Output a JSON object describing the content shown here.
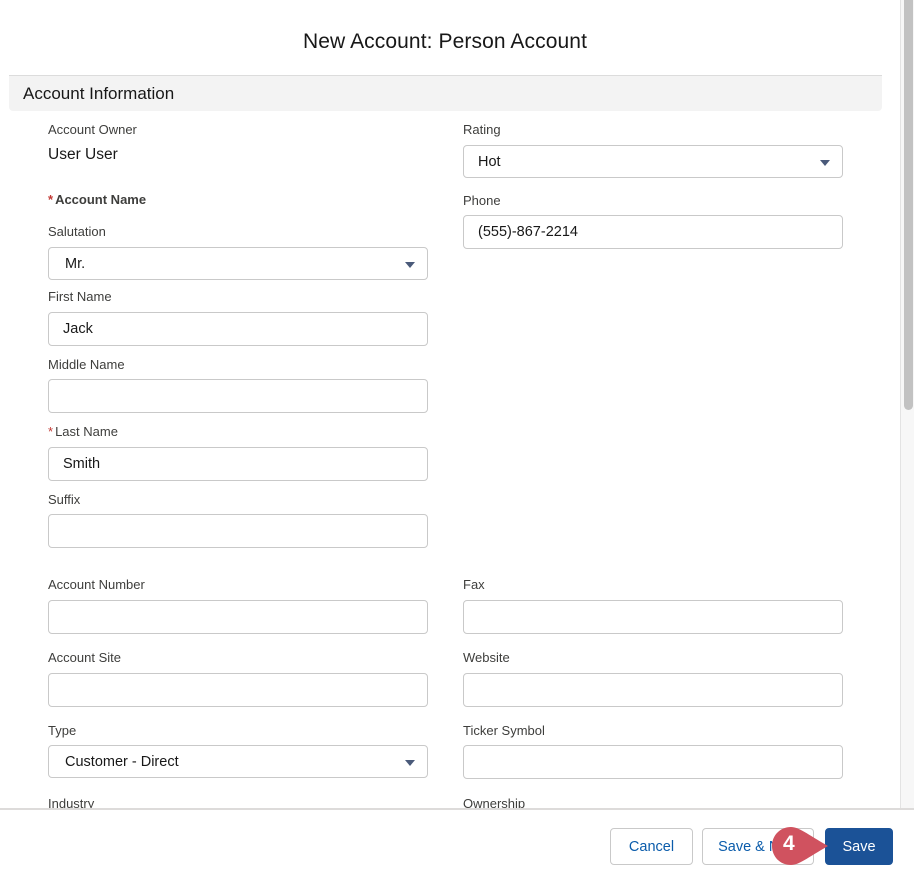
{
  "modal": {
    "title": "New Account: Person Account"
  },
  "section": {
    "title": "Account Information"
  },
  "fields": {
    "account_owner": {
      "label": "Account Owner",
      "value": "User User"
    },
    "rating": {
      "label": "Rating",
      "value": "Hot"
    },
    "account_name": {
      "label": "Account Name",
      "required_mark": "*"
    },
    "phone": {
      "label": "Phone",
      "value": "(555)-867-2214"
    },
    "salutation": {
      "label": "Salutation",
      "value": "Mr."
    },
    "first_name": {
      "label": "First Name",
      "value": "Jack"
    },
    "middle_name": {
      "label": "Middle Name",
      "value": ""
    },
    "last_name": {
      "label": "Last Name",
      "value": "Smith",
      "required_mark": "*"
    },
    "suffix": {
      "label": "Suffix",
      "value": ""
    },
    "account_number": {
      "label": "Account Number",
      "value": ""
    },
    "fax": {
      "label": "Fax",
      "value": ""
    },
    "account_site": {
      "label": "Account Site",
      "value": ""
    },
    "website": {
      "label": "Website",
      "value": ""
    },
    "type": {
      "label": "Type",
      "value": "Customer - Direct"
    },
    "ticker_symbol": {
      "label": "Ticker Symbol",
      "value": ""
    },
    "industry": {
      "label": "Industry"
    },
    "ownership": {
      "label": "Ownership"
    }
  },
  "footer": {
    "cancel_label": "Cancel",
    "save_new_label": "Save & New",
    "save_label": "Save"
  },
  "callout": {
    "step": "4",
    "color": "#d0525f"
  },
  "colors": {
    "brand": "#1b5297",
    "required": "#c23934"
  }
}
